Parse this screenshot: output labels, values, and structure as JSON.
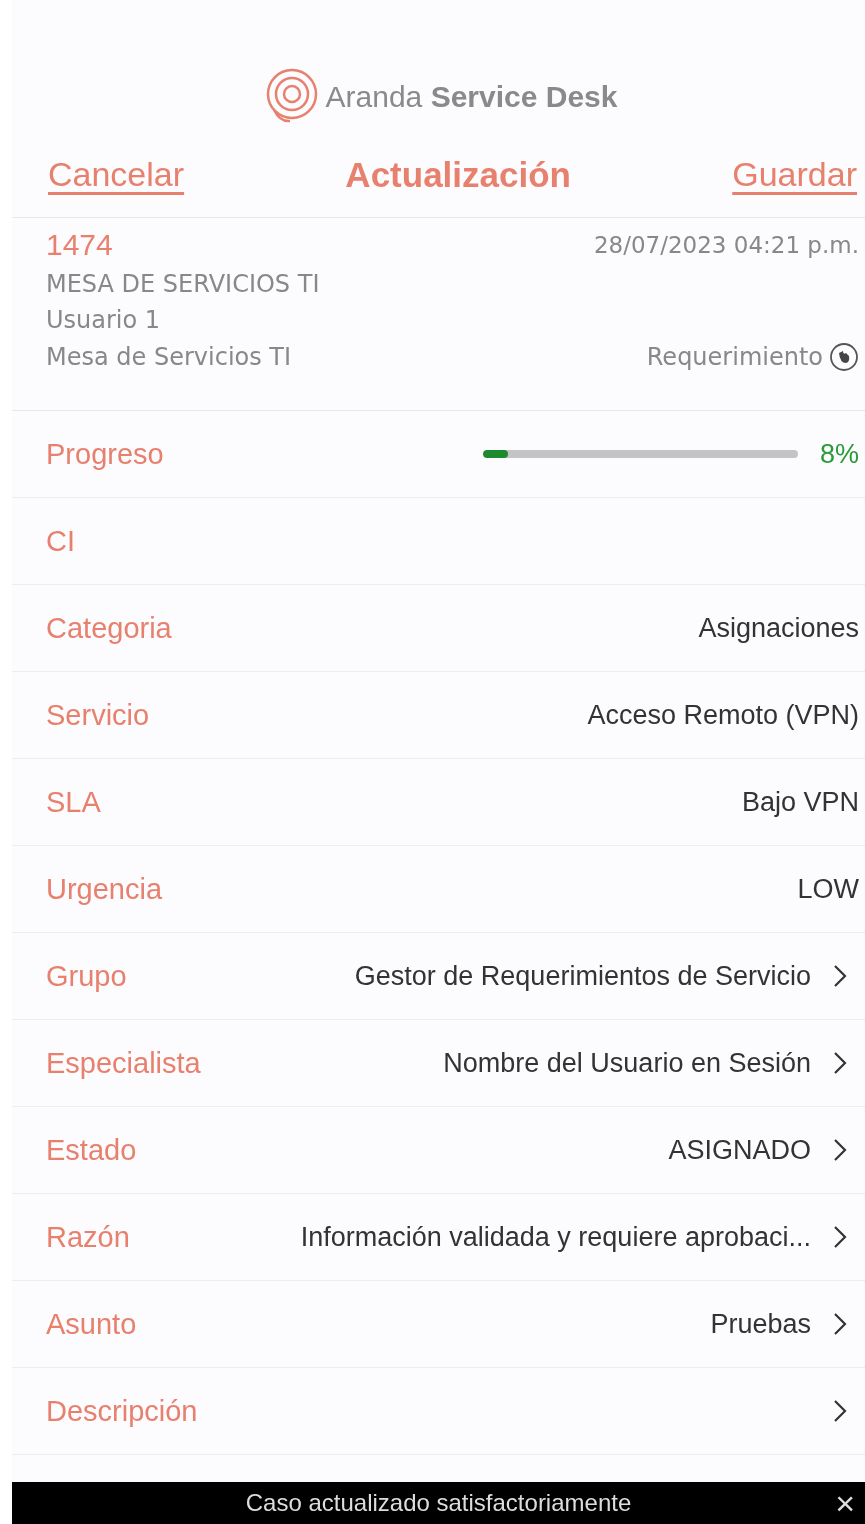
{
  "brand": {
    "name_light": "Aranda",
    "name_bold": "Service Desk"
  },
  "nav": {
    "cancel": "Cancelar",
    "title": "Actualización",
    "save": "Guardar"
  },
  "case": {
    "number": "1474",
    "date": "28/07/2023 04:21 p.m.",
    "service_desk": "MESA DE SERVICIOS TI",
    "user": "Usuario 1",
    "project": "Mesa de Servicios TI",
    "type": "Requerimiento"
  },
  "progress": {
    "label": "Progreso",
    "level": 0.08,
    "reading": "8%"
  },
  "fields": [
    {
      "label": "CI",
      "chevron": false
    },
    {
      "label": "Categoria",
      "value": "Asignaciones",
      "chevron": false
    },
    {
      "label": "Servicio",
      "value": "Acceso Remoto (VPN)",
      "chevron": false
    },
    {
      "label": "SLA",
      "value": "Bajo VPN",
      "chevron": false
    },
    {
      "label": "Urgencia",
      "value": "LOW",
      "chevron": false
    },
    {
      "label": "Grupo",
      "value": "Gestor de Requerimientos de Servicio",
      "chevron": true
    },
    {
      "label": "Especialista",
      "value": "Nombre del Usuario en Sesión",
      "chevron": true
    },
    {
      "label": "Estado",
      "value": "ASIGNADO",
      "chevron": true
    },
    {
      "label": "Razón",
      "value": "Información validada y requiere aprobaci...",
      "chevron": true
    },
    {
      "label": "Asunto",
      "value": "Pruebas",
      "chevron": true
    },
    {
      "label": "Descripción",
      "chevron": true
    }
  ],
  "toast": {
    "message": "Caso actualizado satisfactoriamente",
    "close": "×"
  }
}
